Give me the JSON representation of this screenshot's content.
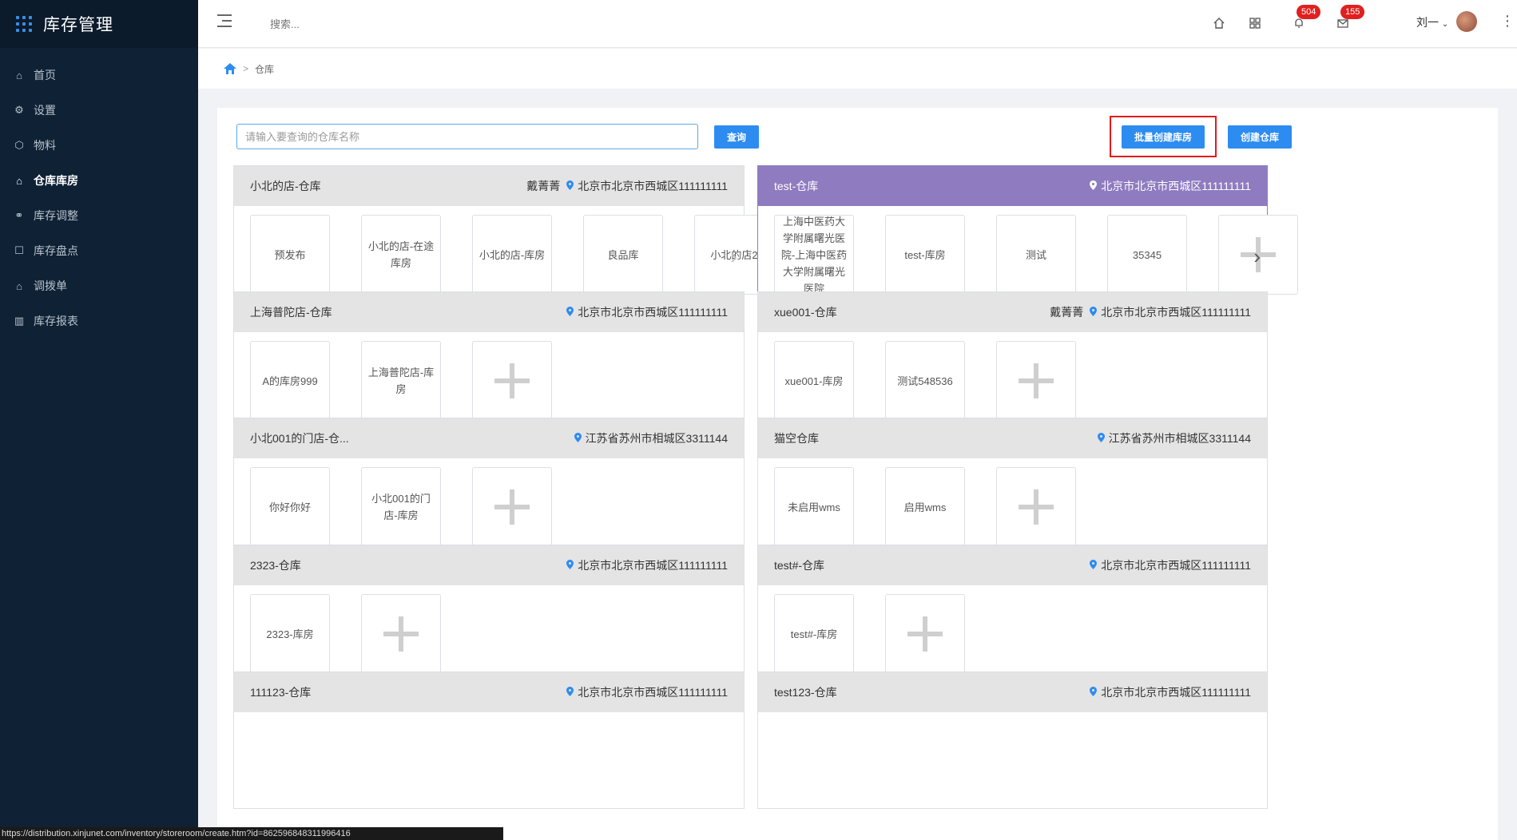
{
  "app": {
    "title": "库存管理"
  },
  "sidebar": {
    "items": [
      {
        "label": "首页",
        "icon": "home-icon",
        "active": false
      },
      {
        "label": "设置",
        "icon": "gear-icon",
        "active": false
      },
      {
        "label": "物料",
        "icon": "box-icon",
        "active": false
      },
      {
        "label": "仓库库房",
        "icon": "warehouse-icon",
        "active": true
      },
      {
        "label": "库存调整",
        "icon": "adjust-icon",
        "active": false
      },
      {
        "label": "库存盘点",
        "icon": "inventory-check-icon",
        "active": false
      },
      {
        "label": "调拨单",
        "icon": "transfer-icon",
        "active": false
      },
      {
        "label": "库存报表",
        "icon": "bar-chart-icon",
        "active": false
      }
    ]
  },
  "header": {
    "search_placeholder": "搜索...",
    "badge_bell": "504",
    "badge_mail": "155",
    "user_name": "刘一"
  },
  "breadcrumb": {
    "current": "仓库"
  },
  "toolbar": {
    "search_placeholder": "请输入要查询的仓库名称",
    "query_label": "查询",
    "batch_create_label": "批量创建库房",
    "create_label": "创建仓库"
  },
  "cards": [
    {
      "title": "小北的店-仓库",
      "manager": "戴菁菁",
      "address": "北京市北京市西城区111111111",
      "rooms": [
        "预发布",
        "小北的店-在途库房",
        "小北的店-库房",
        "良品库",
        "小北的店2"
      ],
      "has_add": false,
      "has_arrow": true,
      "active": false
    },
    {
      "title": "test-仓库",
      "manager": "",
      "address": "北京市北京市西城区111111111",
      "rooms": [
        "上海中医药大学附属曙光医院-上海中医药大学附属曙光医院",
        "test-库房",
        "测试",
        "35345"
      ],
      "has_add": true,
      "has_arrow": true,
      "active": true
    },
    {
      "title": "上海普陀店-仓库",
      "manager": "",
      "address": "北京市北京市西城区111111111",
      "rooms": [
        "A的库房999",
        "上海普陀店-库房"
      ],
      "has_add": true,
      "has_arrow": false,
      "active": false
    },
    {
      "title": "xue001-仓库",
      "manager": "戴菁菁",
      "address": "北京市北京市西城区111111111",
      "rooms": [
        "xue001-库房",
        "测试548536"
      ],
      "has_add": true,
      "has_arrow": false,
      "active": false
    },
    {
      "title": "小北001的门店-仓...",
      "manager": "",
      "address": "江苏省苏州市相城区3311144",
      "rooms": [
        "你好你好",
        "小北001的门店-库房"
      ],
      "has_add": true,
      "has_arrow": false,
      "active": false
    },
    {
      "title": "猫空仓库",
      "manager": "",
      "address": "江苏省苏州市相城区3311144",
      "rooms": [
        "未启用wms",
        "启用wms"
      ],
      "has_add": true,
      "has_arrow": false,
      "active": false
    },
    {
      "title": "2323-仓库",
      "manager": "",
      "address": "北京市北京市西城区111111111",
      "rooms": [
        "2323-库房"
      ],
      "has_add": true,
      "has_arrow": false,
      "active": false
    },
    {
      "title": "test#-仓库",
      "manager": "",
      "address": "北京市北京市西城区111111111",
      "rooms": [
        "test#-库房"
      ],
      "has_add": true,
      "has_arrow": false,
      "active": false
    },
    {
      "title": "111123-仓库",
      "manager": "",
      "address": "北京市北京市西城区111111111",
      "rooms": [],
      "has_add": false,
      "has_arrow": false,
      "active": false
    },
    {
      "title": "test123-仓库",
      "manager": "",
      "address": "北京市北京市西城区111111111",
      "rooms": [],
      "has_add": false,
      "has_arrow": false,
      "active": false
    }
  ],
  "status_bar": {
    "url": "https://distribution.xinjunet.com/inventory/storeroom/create.htm?id=862596848311996416"
  },
  "colors": {
    "sidebar_bg": "#0f2135",
    "primary": "#2d8cf0",
    "active_card": "#8e7bc0",
    "highlight": "#e41a1a"
  }
}
